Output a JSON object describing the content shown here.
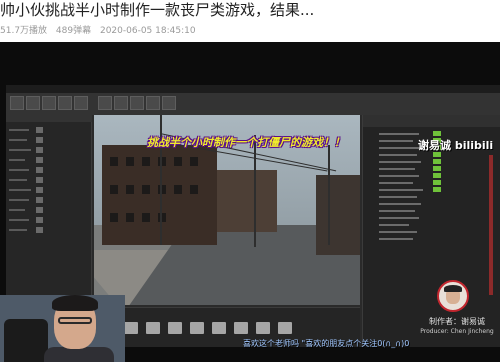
{
  "video": {
    "title": "帅小伙挑战半小时制作一款丧尸类游戏，结果...",
    "views": "51.7万播放",
    "danmaku_count": "489弹幕",
    "date": "2020-06-05 18:45:10"
  },
  "overlay": {
    "caption": "挑战半个小时制作一个打僵尸的游戏！！",
    "watermark": "谢易诚 bilibili"
  },
  "producer": {
    "label_cn": "制作者：谢易诚",
    "label_en": "Producer: Chen Jincheng"
  },
  "danmaku": {
    "text": "喜欢这个老师吗 \"喜欢的朋友点个关注0(∩_∩)0"
  },
  "colors": {
    "caption_yellow": "#f0ec2c",
    "caption_outline": "#5a0e8a",
    "danmaku_blue": "#9fc6ff",
    "outliner_green": "#6fc23a"
  }
}
